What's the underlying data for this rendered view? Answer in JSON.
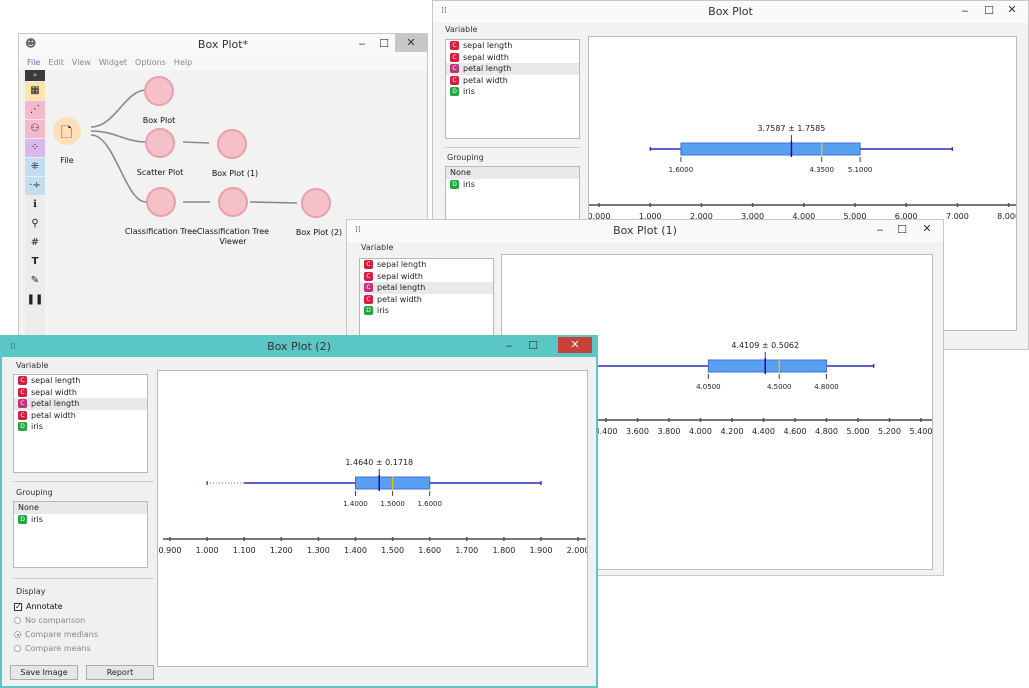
{
  "colors": {
    "box_fill": "#5aa0f0",
    "box_edge": "#3c6fe0",
    "whisker": "#0000b0",
    "median": "#f0c000",
    "teal": "#5bc7c5",
    "close_red": "#c8413a"
  },
  "controls": {
    "minimize": "‒",
    "maximize": "☐",
    "close": "✕"
  },
  "panel_labels": {
    "variable": "Variable",
    "grouping": "Grouping",
    "display": "Display"
  },
  "variables": [
    {
      "badge": "C",
      "name": "sepal length"
    },
    {
      "badge": "C",
      "name": "sepal width"
    },
    {
      "badge": "C",
      "name": "petal length"
    },
    {
      "badge": "C",
      "name": "petal width"
    },
    {
      "badge": "D",
      "name": "iris"
    }
  ],
  "grouping": [
    {
      "badge": "",
      "name": "None"
    },
    {
      "badge": "D",
      "name": "iris"
    }
  ],
  "canvas": {
    "title": "Box Plot*",
    "menu": [
      "File",
      "Edit",
      "View",
      "Widget",
      "Options",
      "Help"
    ],
    "toolbox_icons": [
      "collapse-icon",
      "data-table-icon",
      "scatter-icon",
      "tree-icon",
      "dots-icon",
      "heatmap-icon",
      "sieve-icon",
      "info-icon",
      "key-icon",
      "hash-icon",
      "text-icon",
      "pencil-icon",
      "pause-icon",
      "help-icon"
    ],
    "nodes": {
      "file": "File",
      "boxplot": "Box Plot",
      "scatter": "Scatter Plot",
      "boxplot1": "Box Plot (1)",
      "classtree": "Classification Tree",
      "viewer_l1": "Classification Tree",
      "viewer_l2": "Viewer",
      "boxplot2": "Box Plot (2)"
    }
  },
  "box_plot": {
    "title": "Box Plot",
    "annotation": "3.7587 ± 1.7585",
    "quartile_labels": [
      "1.6000",
      "4.3500",
      "5.1000"
    ],
    "ticks": [
      "0.000",
      "1.000",
      "2.000",
      "3.000",
      "4.000",
      "5.000",
      "6.000",
      "7.000",
      "8.000"
    ]
  },
  "box_plot_1": {
    "title": "Box Plot (1)",
    "annotation": "4.4109 ± 0.5062",
    "quartile_labels": [
      "4.0500",
      "4.5000",
      "4.8000"
    ],
    "ticks": [
      "3.400",
      "3.600",
      "3.800",
      "4.000",
      "4.200",
      "4.400",
      "4.600",
      "4.800",
      "5.000",
      "5.200",
      "5.400"
    ]
  },
  "box_plot_2": {
    "title": "Box Plot (2)",
    "annotation": "1.4640 ± 0.1718",
    "quartile_labels": [
      "1.4000",
      "1.5000",
      "1.6000"
    ],
    "ticks": [
      "0.900",
      "1.000",
      "1.100",
      "1.200",
      "1.300",
      "1.400",
      "1.500",
      "1.600",
      "1.700",
      "1.800",
      "1.900",
      "2.000"
    ],
    "display": {
      "annotate": "Annotate",
      "no_comparison": "No comparison",
      "compare_medians": "Compare medians",
      "compare_means": "Compare means"
    },
    "buttons": {
      "save": "Save Image",
      "report": "Report"
    }
  },
  "chart_data": [
    {
      "type": "box",
      "name": "Box Plot",
      "variable": "petal length",
      "xlim": [
        0,
        8
      ],
      "min": 1.0,
      "q1": 1.6,
      "median": 4.35,
      "q3": 5.1,
      "max": 6.9,
      "mean": 3.7587,
      "std": 1.7585,
      "whisker_low": 1.0,
      "whisker_high": 6.9
    },
    {
      "type": "box",
      "name": "Box Plot (1)",
      "variable": "petal length",
      "xlim": [
        3.3,
        5.4
      ],
      "min": 3.0,
      "q1": 4.05,
      "median": 4.5,
      "q3": 4.8,
      "max": 5.1,
      "mean": 4.4109,
      "std": 0.5062
    },
    {
      "type": "box",
      "name": "Box Plot (2)",
      "variable": "petal length",
      "xlim": [
        0.9,
        2.0
      ],
      "min": 1.0,
      "q1": 1.4,
      "median": 1.5,
      "q3": 1.6,
      "max": 1.9,
      "mean": 1.464,
      "std": 0.1718
    }
  ]
}
